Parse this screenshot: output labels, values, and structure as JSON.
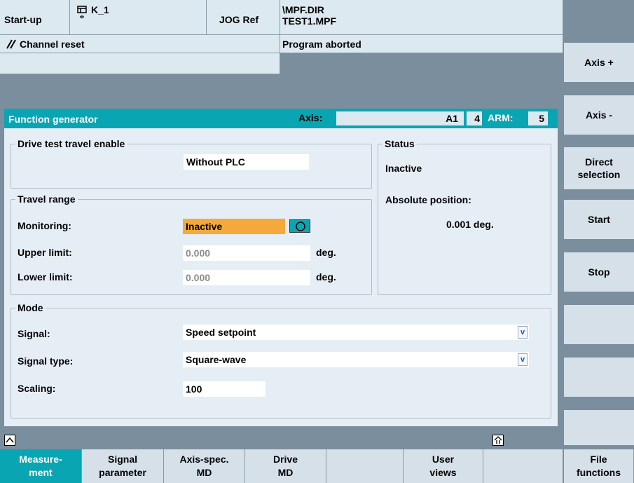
{
  "header": {
    "mode": "Start-up",
    "channel": "K_1",
    "jog_mode": "JOG Ref",
    "program_path_line1": "\\MPF.DIR",
    "program_path_line2": "TEST1.MPF",
    "channel_status": "Channel reset",
    "program_status": "Program aborted"
  },
  "function_bar": {
    "title": "Function generator",
    "axis_label": "Axis:",
    "axis_name": "A1",
    "axis_number": "4",
    "arm_label": "ARM:",
    "arm_number": "5"
  },
  "drive_test": {
    "title": "Drive test travel enable",
    "value": "Without PLC"
  },
  "status": {
    "title": "Status",
    "state": "Inactive",
    "position_label": "Absolute position:",
    "position_value": "0.001 deg."
  },
  "travel_range": {
    "title": "Travel range",
    "monitoring_label": "Monitoring:",
    "monitoring_value": "Inactive",
    "upper_label": "Upper limit:",
    "upper_value": "0.000",
    "upper_unit": "deg.",
    "lower_label": "Lower limit:",
    "lower_value": "0.000",
    "lower_unit": "deg."
  },
  "mode": {
    "title": "Mode",
    "signal_label": "Signal:",
    "signal_value": "Speed setpoint",
    "signal_type_label": "Signal type:",
    "signal_type_value": "Square-wave",
    "scaling_label": "Scaling:",
    "scaling_value": "100"
  },
  "vertical_softkeys": [
    {
      "line1": "Axis +",
      "line2": ""
    },
    {
      "line1": "Axis -",
      "line2": ""
    },
    {
      "line1": "Direct",
      "line2": "selection"
    },
    {
      "line1": "Start",
      "line2": ""
    },
    {
      "line1": "Stop",
      "line2": ""
    },
    {
      "line1": "",
      "line2": ""
    },
    {
      "line1": "",
      "line2": ""
    },
    {
      "line1": "",
      "line2": ""
    }
  ],
  "horizontal_softkeys": [
    {
      "line1": "Measure-",
      "line2": "ment"
    },
    {
      "line1": "Signal",
      "line2": "parameter"
    },
    {
      "line1": "Axis-spec.",
      "line2": "MD"
    },
    {
      "line1": "Drive",
      "line2": "MD"
    },
    {
      "line1": "",
      "line2": ""
    },
    {
      "line1": "User",
      "line2": "views"
    },
    {
      "line1": "",
      "line2": ""
    },
    {
      "line1": "File",
      "line2": "functions"
    }
  ],
  "colors": {
    "accent": "#0aa5b3",
    "monitoring_highlight": "#f5a93a",
    "background": "#7b8e9d",
    "panel": "#e6eef5"
  },
  "icons": {
    "channel": "channel-window-icon",
    "reset": "channel-reset-icon",
    "monitoring": "monitoring-circle-icon",
    "recall": "recall-icon",
    "etc": "etc-icon"
  }
}
